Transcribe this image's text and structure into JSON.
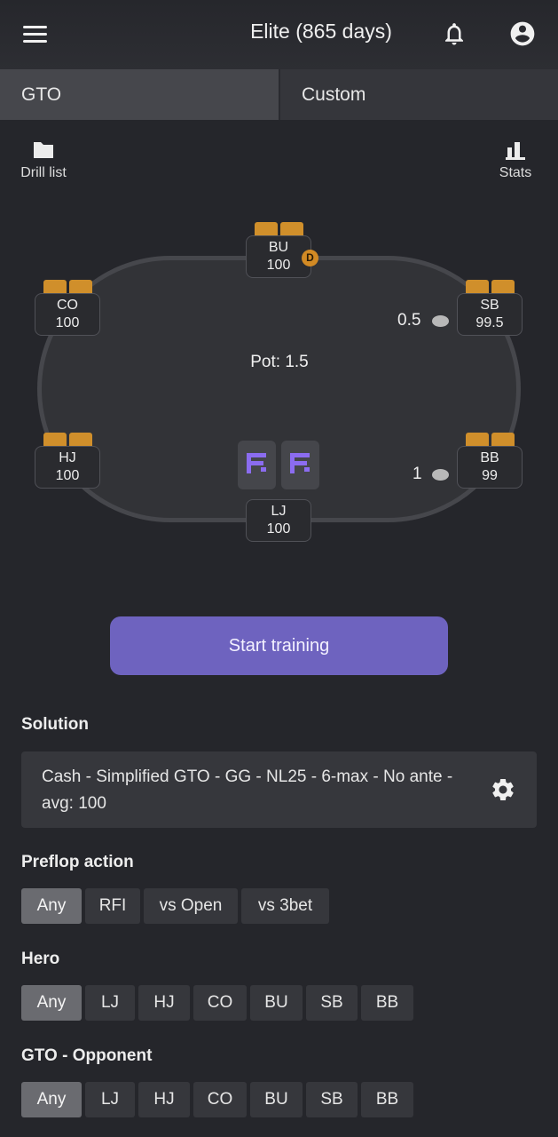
{
  "header": {
    "title": "Elite (865 days)",
    "menu_icon": "hamburger-icon",
    "notification_icon": "bell-icon",
    "account_icon": "account-circle-icon"
  },
  "tabs": [
    {
      "label": "GTO",
      "active": true
    },
    {
      "label": "Custom",
      "active": false
    }
  ],
  "tools": {
    "drill_list": "Drill list",
    "stats": "Stats"
  },
  "table": {
    "pot": "Pot: 1.5",
    "dealer": "D",
    "seats": {
      "BU": {
        "name": "BU",
        "stack": "100"
      },
      "CO": {
        "name": "CO",
        "stack": "100"
      },
      "SB": {
        "name": "SB",
        "stack": "99.5",
        "bet": "0.5"
      },
      "HJ": {
        "name": "HJ",
        "stack": "100"
      },
      "BB": {
        "name": "BB",
        "stack": "99",
        "bet": "1"
      },
      "LJ": {
        "name": "LJ",
        "stack": "100"
      }
    }
  },
  "start_button": "Start training",
  "solution": {
    "title": "Solution",
    "value": "Cash - Simplified GTO - GG - NL25 - 6-max - No ante - avg: 100",
    "settings_icon": "gear-icon"
  },
  "preflop": {
    "title": "Preflop action",
    "options": [
      "Any",
      "RFI",
      "vs Open",
      "vs 3bet"
    ],
    "selected": "Any"
  },
  "hero": {
    "title": "Hero",
    "options": [
      "Any",
      "LJ",
      "HJ",
      "CO",
      "BU",
      "SB",
      "BB"
    ],
    "selected": "Any"
  },
  "opponent": {
    "title": "GTO - Opponent",
    "options": [
      "Any",
      "LJ",
      "HJ",
      "CO",
      "BU",
      "SB",
      "BB"
    ],
    "selected": "Any"
  },
  "colors": {
    "background": "#25262b",
    "accent": "#6e63bf",
    "card_back": "#d08f2b",
    "dealer": "#d28a24"
  }
}
